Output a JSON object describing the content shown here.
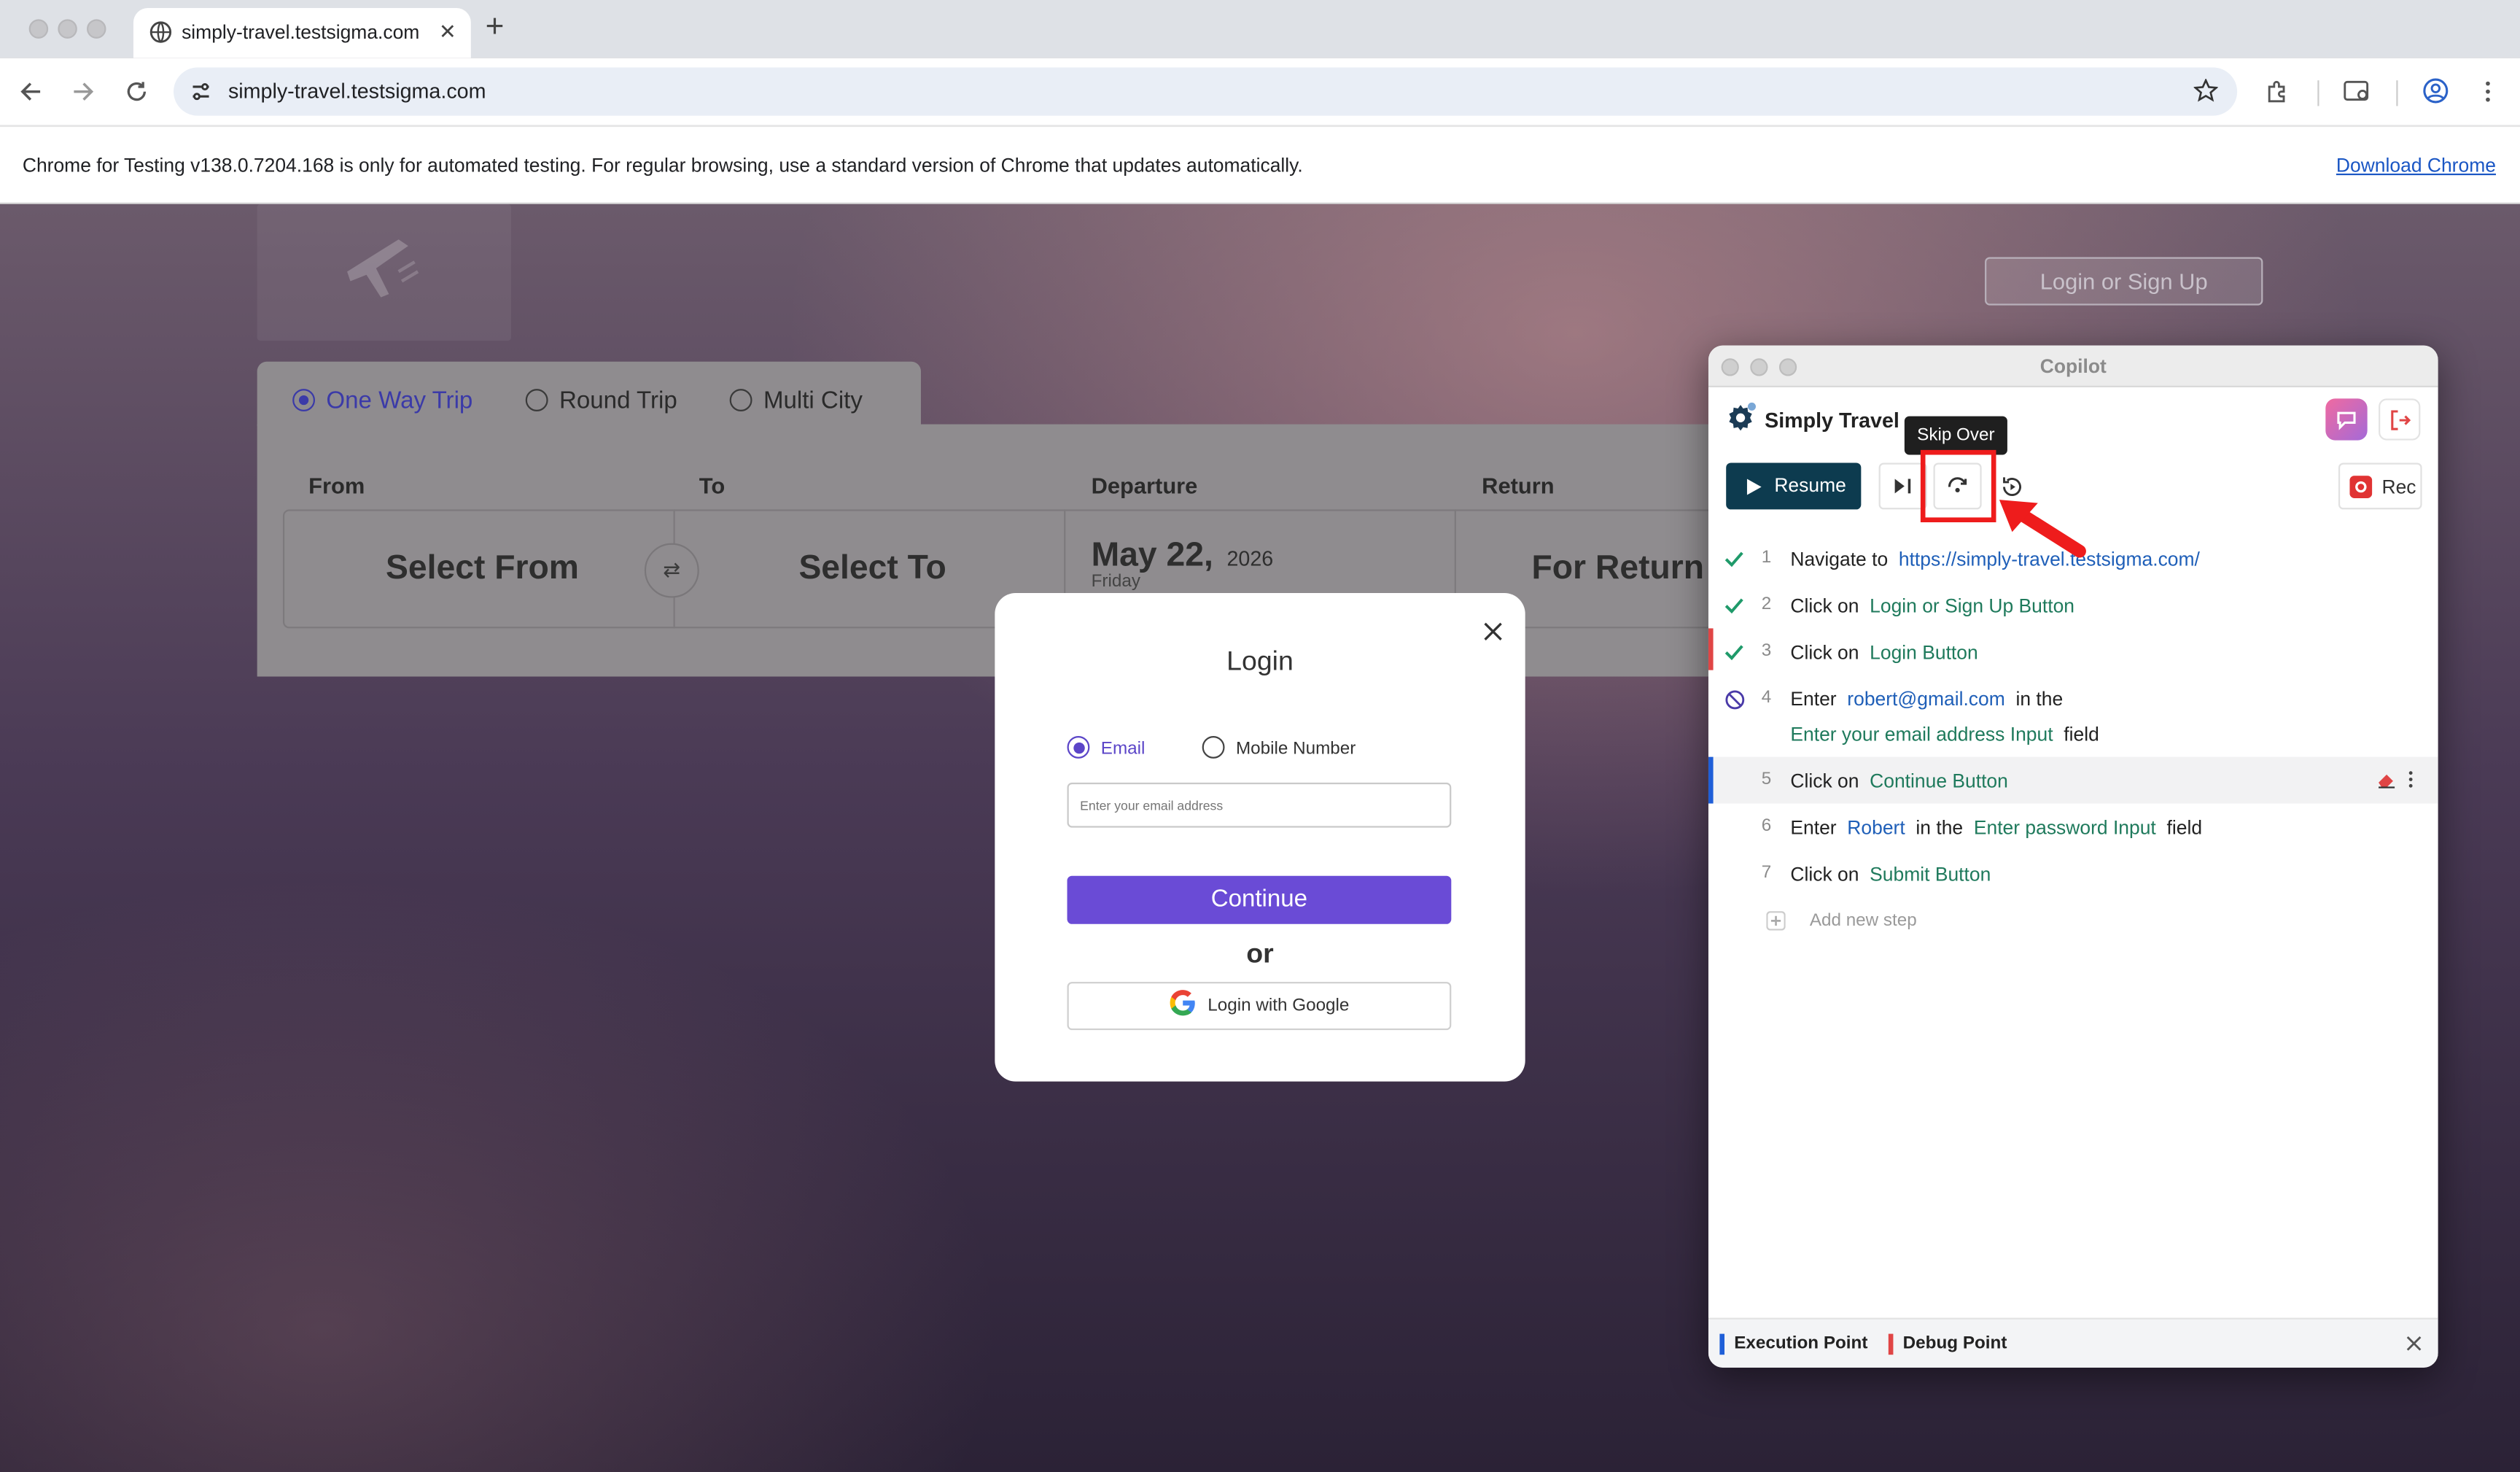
{
  "browser": {
    "tab_title": "simply-travel.testsigma.com",
    "url": "simply-travel.testsigma.com",
    "info_message": "Chrome for Testing v138.0.7204.168 is only for automated testing. For regular browsing, use a standard version of Chrome that updates automatically.",
    "download_link": "Download Chrome"
  },
  "site": {
    "login_signup": "Login or Sign Up",
    "trip_types": [
      "One Way Trip",
      "Round Trip",
      "Multi City"
    ],
    "selected_trip": "One Way Trip",
    "labels": {
      "from": "From",
      "to": "To",
      "departure": "Departure",
      "return": "Return"
    },
    "from_value": "Select From",
    "to_value": "Select To",
    "departure_day": "May 22,",
    "departure_year": "2026",
    "departure_weekday": "Friday",
    "return_value": "For Return"
  },
  "login_modal": {
    "title": "Login",
    "options": [
      "Email",
      "Mobile Number"
    ],
    "selected_option": "Email",
    "email_placeholder": "Enter your email address",
    "continue_label": "Continue",
    "or_label": "or",
    "google_label": "Login with Google"
  },
  "copilot": {
    "window_title": "Copilot",
    "app_name": "Simply Travel",
    "resume_label": "Resume",
    "rec_label": "Rec",
    "tooltip": "Skip Over",
    "steps": [
      {
        "num": "1",
        "status": "done",
        "action": "Navigate to",
        "target": "https://simply-travel.testsigma.com/"
      },
      {
        "num": "2",
        "status": "done",
        "action": "Click on",
        "target": "Login or Sign Up Button"
      },
      {
        "num": "3",
        "status": "done",
        "action": "Click on",
        "target": "Login Button"
      },
      {
        "num": "4",
        "status": "skipped",
        "action": "Enter",
        "value": "robert@gmail.com",
        "mid": "in the",
        "target": "Enter your email address Input",
        "tail": "field"
      },
      {
        "num": "5",
        "status": "current",
        "action": "Click on",
        "target": "Continue Button"
      },
      {
        "num": "6",
        "status": "pending",
        "action": "Enter",
        "value": "Robert",
        "mid": "in the",
        "target": "Enter password Input",
        "tail": "field"
      },
      {
        "num": "7",
        "status": "pending",
        "action": "Click on",
        "target": "Submit Button"
      }
    ],
    "add_step": "Add new step",
    "legend": {
      "execution": "Execution Point",
      "debug": "Debug Point"
    },
    "colors": {
      "execution": "#1f5fd8",
      "debug": "#e04545",
      "check": "#1f9a6a",
      "resume_bg": "#0d3b4f"
    }
  }
}
